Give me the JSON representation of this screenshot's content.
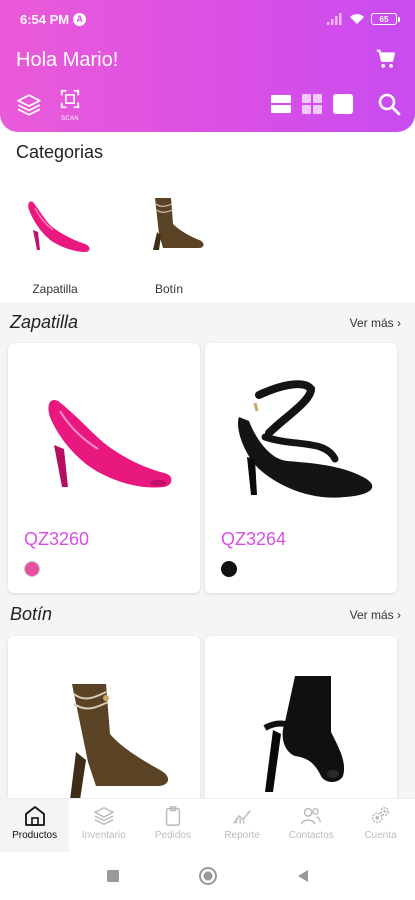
{
  "status": {
    "time": "6:54 PM",
    "notif_badge": "A",
    "battery": "65"
  },
  "header": {
    "greeting": "Hola Mario!",
    "scan_label": "SCAN"
  },
  "categories": {
    "title": "Categorias",
    "items": [
      {
        "label": "Zapatilla"
      },
      {
        "label": "Botín"
      }
    ]
  },
  "sections": [
    {
      "title": "Zapatilla",
      "more": "Ver más",
      "products": [
        {
          "code": "QZ3260",
          "color": "#e94ea1"
        },
        {
          "code": "QZ3264",
          "color": "#111111"
        }
      ]
    },
    {
      "title": "Botín",
      "more": "Ver más"
    }
  ],
  "nav": {
    "items": [
      {
        "label": "Productos",
        "icon": "store-icon",
        "active": true
      },
      {
        "label": "Inventario",
        "icon": "layers-icon"
      },
      {
        "label": "Pedidos",
        "icon": "clipboard-icon"
      },
      {
        "label": "Reporte",
        "icon": "report-icon"
      },
      {
        "label": "Contactos",
        "icon": "contacts-icon"
      },
      {
        "label": "Cuenta",
        "icon": "gears-icon"
      }
    ]
  },
  "colors": {
    "accent": "#d94fe6",
    "header_start": "#ea5ad9",
    "header_end": "#c84cf0"
  }
}
